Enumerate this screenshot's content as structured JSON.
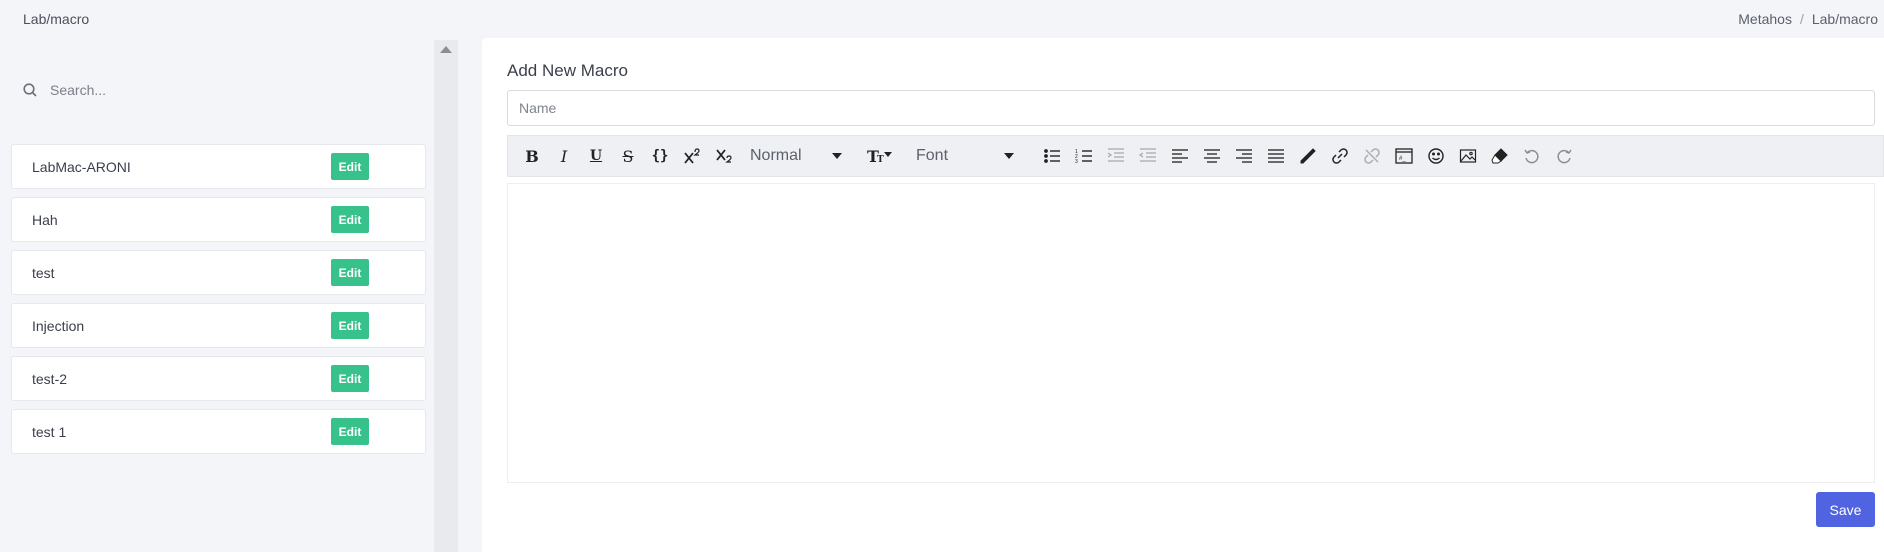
{
  "topbar": {
    "title": "Lab/macro",
    "breadcrumb": [
      "Metahos",
      "Lab/macro"
    ],
    "breadcrumb_sep": "/"
  },
  "sidebar": {
    "search_placeholder": "Search...",
    "macros": [
      {
        "name": "LabMac-ARONI",
        "edit_label": "Edit"
      },
      {
        "name": "Hah",
        "edit_label": "Edit"
      },
      {
        "name": "test",
        "edit_label": "Edit"
      },
      {
        "name": "Injection",
        "edit_label": "Edit"
      },
      {
        "name": "test-2",
        "edit_label": "Edit"
      },
      {
        "name": "test 1",
        "edit_label": "Edit"
      }
    ]
  },
  "main": {
    "title": "Add New Macro",
    "name_placeholder": "Name",
    "toolbar": {
      "paragraph_style": "Normal",
      "font_family": "Font"
    },
    "save_label": "Save"
  },
  "colors": {
    "edit_button": "#36c28a",
    "save_button": "#5063e0"
  }
}
